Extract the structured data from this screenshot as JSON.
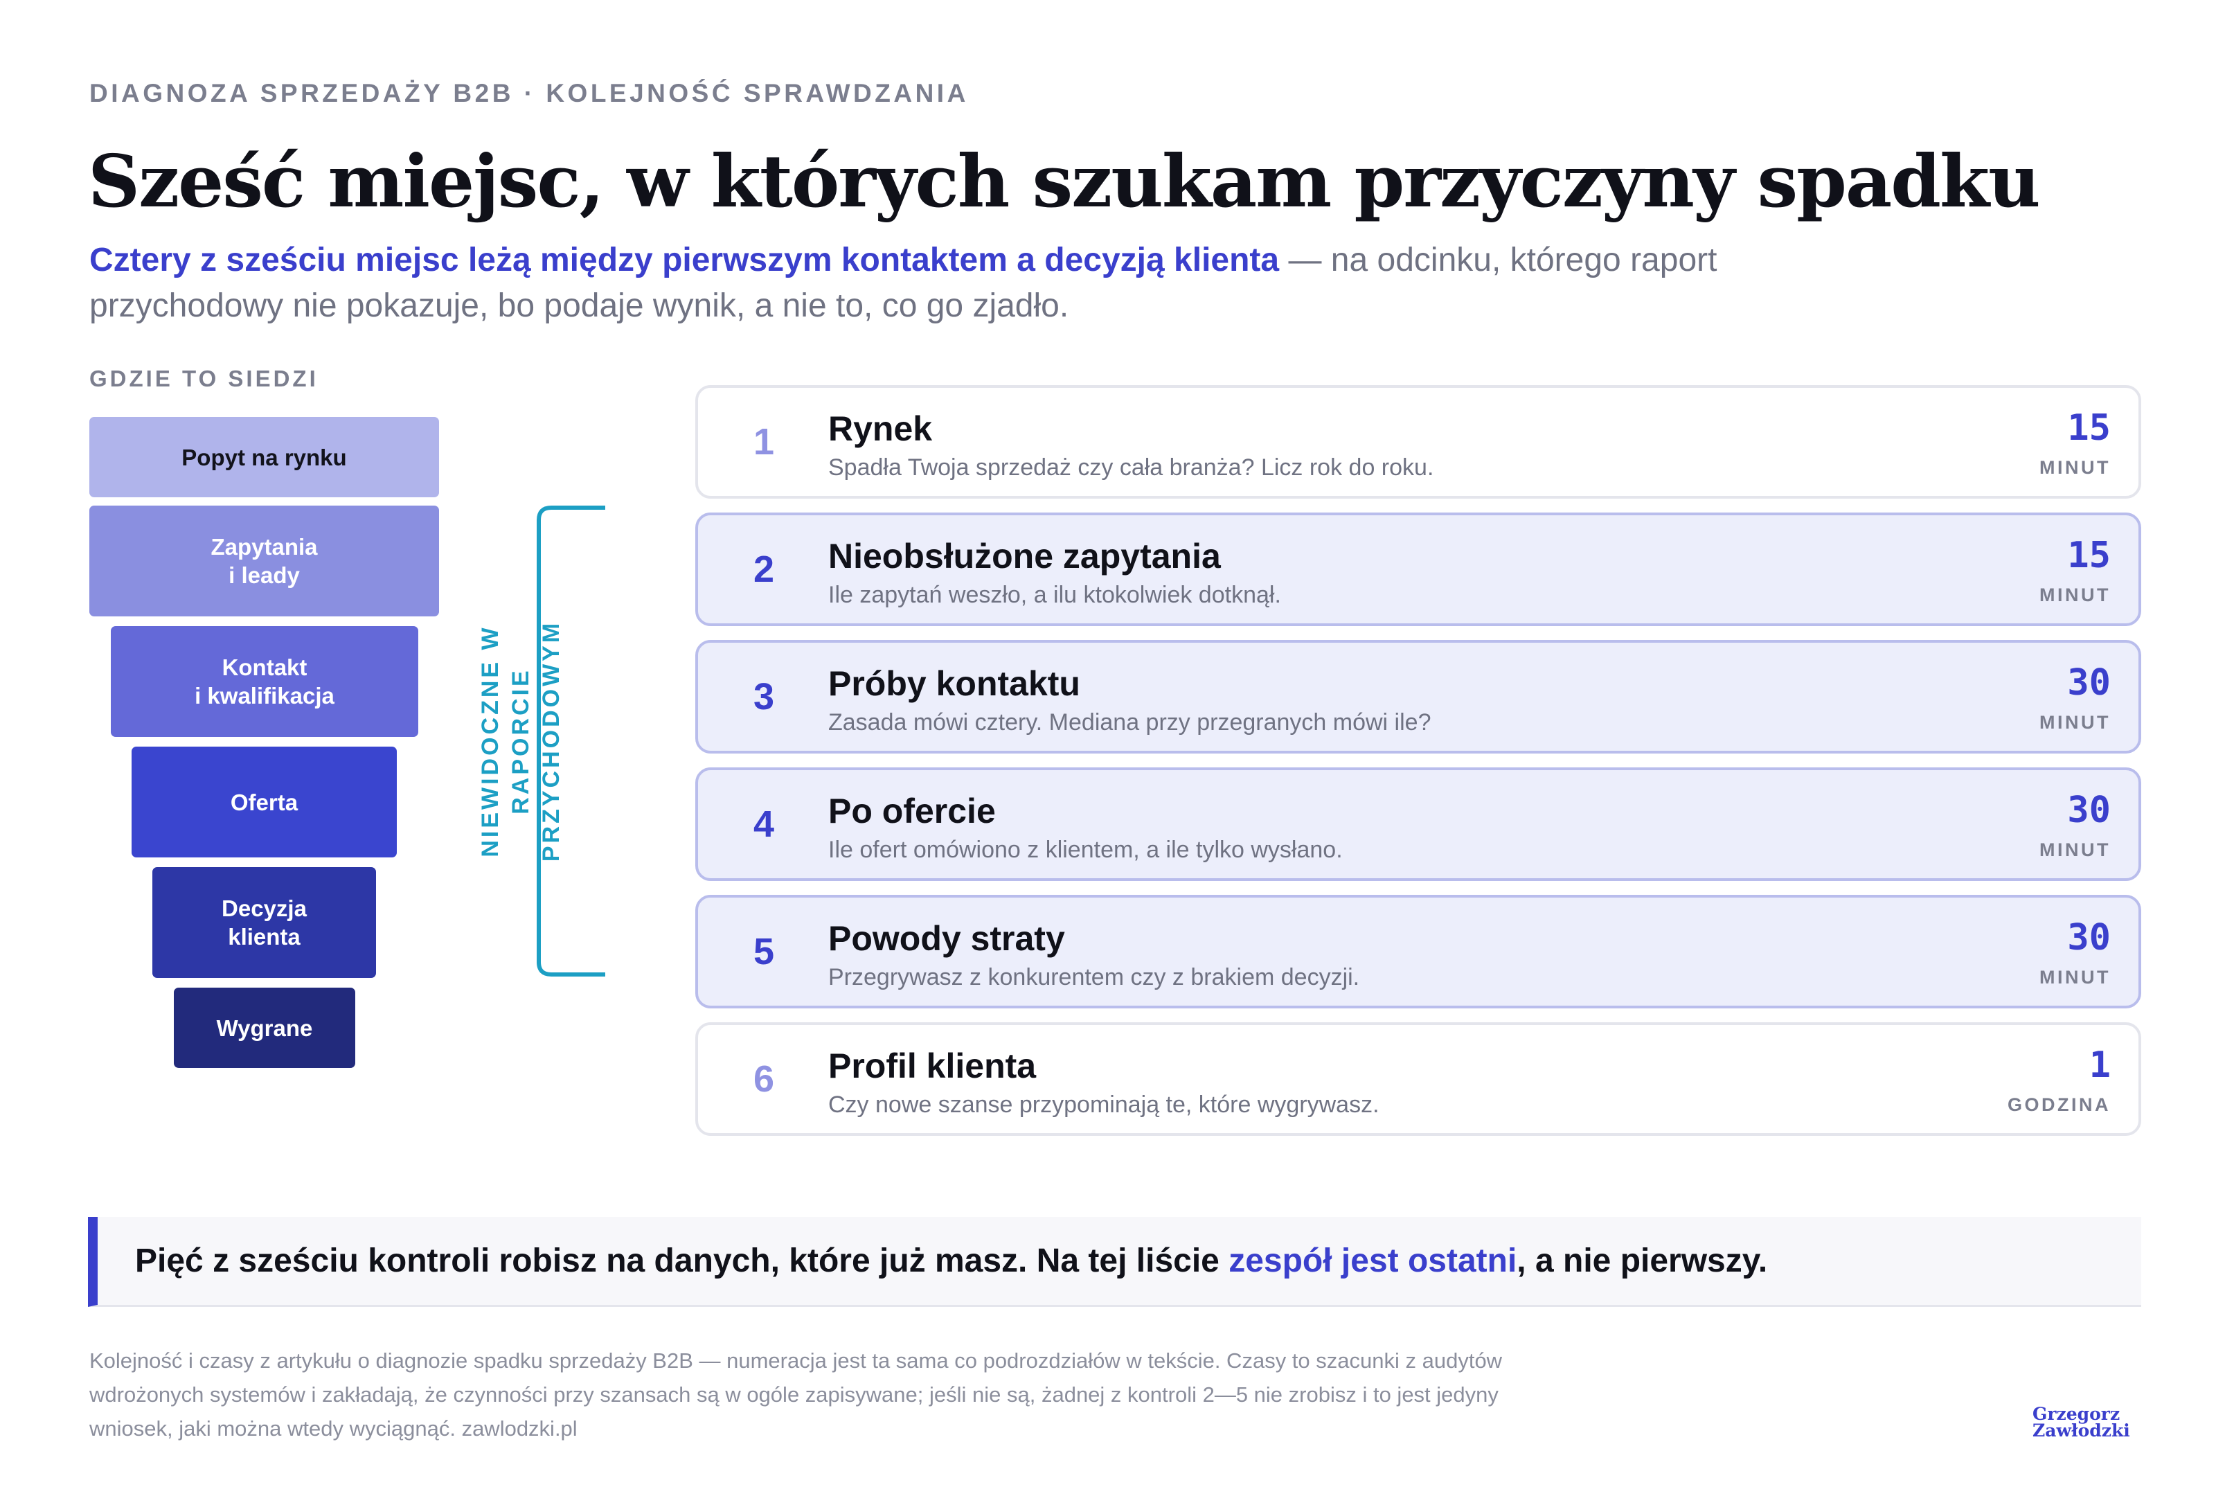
{
  "header": {
    "eyebrow": "DIAGNOZA SPRZEDAŻY B2B · KOLEJNOŚĆ SPRAWDZANIA",
    "title": "Sześć miejsc, w których szukam przyczyny spadku",
    "lede_highlight": "Cztery z sześciu miejsc leżą między pierwszym kontaktem a decyzją klienta",
    "lede_rest": " — na odcinku, którego raport przychodowy nie pokazuje, bo podaje wynik, a nie to, co go zjadło."
  },
  "funnel": {
    "label": "GDZIE TO SIEDZI",
    "steps": [
      {
        "label": "Popyt na rynku",
        "color": "#b0b4eb",
        "text_color": "#12131c"
      },
      {
        "label": "Zapytania\ni leady",
        "color": "#8a8fe0",
        "text_color": "#ffffff"
      },
      {
        "label": "Kontakt\ni kwalifikacja",
        "color": "#6469d8",
        "text_color": "#ffffff"
      },
      {
        "label": "Oferta",
        "color": "#3a45cf",
        "text_color": "#ffffff"
      },
      {
        "label": "Decyzja\nklienta",
        "color": "#2d37a6",
        "text_color": "#ffffff"
      },
      {
        "label": "Wygrane",
        "color": "#222a7c",
        "text_color": "#ffffff"
      }
    ],
    "bracket_label": "NIEWIDOCZNE W RAPORCIE\nPRZYCHODOWYM",
    "bracket_color": "#1c9fc4"
  },
  "steps": [
    {
      "number": "1",
      "name": "Rynek",
      "description": "Spadła Twoja sprzedaż czy cała branża? Licz rok do roku.",
      "time": "15",
      "unit": "MINUT",
      "highlighted": false
    },
    {
      "number": "2",
      "name": "Nieobsłużone zapytania",
      "description": "Ile zapytań weszło, a ilu ktokolwiek dotknął.",
      "time": "15",
      "unit": "MINUT",
      "highlighted": true
    },
    {
      "number": "3",
      "name": "Próby kontaktu",
      "description": "Zasada mówi cztery. Mediana przy przegranych mówi ile?",
      "time": "30",
      "unit": "MINUT",
      "highlighted": true
    },
    {
      "number": "4",
      "name": "Po ofercie",
      "description": "Ile ofert omówiono z klientem, a ile tylko wysłano.",
      "time": "30",
      "unit": "MINUT",
      "highlighted": true
    },
    {
      "number": "5",
      "name": "Powody straty",
      "description": "Przegrywasz z konkurentem czy z brakiem decyzji.",
      "time": "30",
      "unit": "MINUT",
      "highlighted": true
    },
    {
      "number": "6",
      "name": "Profil klienta",
      "description": "Czy nowe szanse przypominają te, które wygrywasz.",
      "time": "1",
      "unit": "GODZINA",
      "highlighted": false
    }
  ],
  "callout": {
    "before": "Pięć z sześciu kontroli robisz na danych, które już masz. Na tej liście ",
    "highlight": "zespół jest ostatni",
    "after": ", a nie pierwszy."
  },
  "footnote": "Kolejność i czasy z artykułu o diagnozie spadku sprzedaży B2B — numeracja jest ta sama co podrozdziałów w tekście. Czasy to szacunki z audytów wdrożonych systemów i zakładają, że czynności przy szansach są w ogóle zapisywane; jeśli nie są, żadnej z kontroli 2—5 nie zrobisz i to jest jedyny wniosek, jaki można wtedy wyciągnąć. zawlodzki.pl",
  "brand": "Grzegorz\nZawłodzki",
  "colors": {
    "accent": "#3a3fcc",
    "muted": "#7b7e8e",
    "highlight_card": "#eceefb"
  }
}
